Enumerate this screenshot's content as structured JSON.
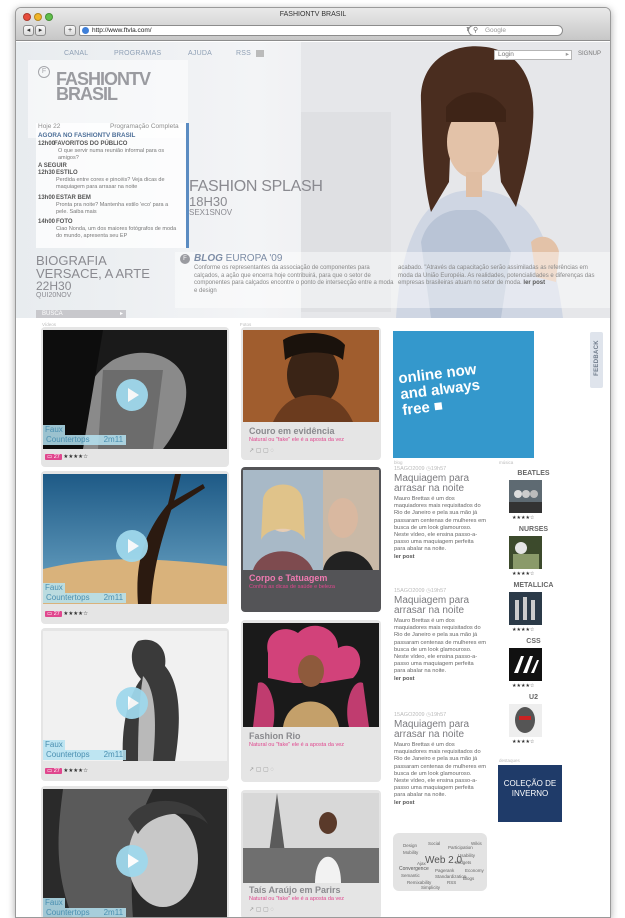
{
  "window": {
    "title": "FASHIONTV BRASIL",
    "url": "http://www.ftvla.com/",
    "search_placeholder": "Google",
    "nav_add": "+"
  },
  "topnav": {
    "items": [
      "CANAL",
      "PROGRAMAS",
      "AJUDA",
      "RSS"
    ],
    "login_placeholder": "Login",
    "signup": "SIGNUP"
  },
  "logo": {
    "line1": "FASHIONTV",
    "line2": "BRASIL"
  },
  "schedule": {
    "time_label": "Hoje 22",
    "full_label": "Programação Completa",
    "now_label": "AGORA NO FASHIONTV BRASIL",
    "now_time": "12h00",
    "now_title": "FAVORITOS DO PÚBLICO",
    "now_desc": "O que servir numa reunião informal para os amigos?",
    "next_label": "A SEGUIR",
    "items": [
      {
        "time": "12h30",
        "title": "ESTILO",
        "desc": "Perdida entre cores e pincéis? Veja dicas de maquiagem para arrasar na noite"
      },
      {
        "time": "13h00",
        "title": "ESTAR BEM",
        "desc": "Pronta pra noite? Mantenha estilo 'eco' para a pele. Saiba mais"
      },
      {
        "time": "14h00",
        "title": "FOTO",
        "desc": "Ciao Nonda, um dos maiores fotógrafos de moda do mundo, apresenta seu EP"
      }
    ]
  },
  "feature": {
    "title": "FASHION SPLASH",
    "time": "18H30",
    "day": "SEX1SNOV"
  },
  "bio": {
    "label": "BIOGRAFIA",
    "title": "VERSACE, A ARTE",
    "time": "22H30",
    "day": "QUI20NOV"
  },
  "blog": {
    "label": "BLOG",
    "title": "EUROPA '09",
    "col1": "Conforme os representantes da associação de componentes para calçados, a ação que encerra hoje contribuirá, para que o setor de componentes para calçados encontre o ponto de intersecção entre a moda e design",
    "col2": "acabado. \"Através da capacitação serão assimiladas as referências em moda da União Européia. As realidades, potencialidades e diferenças das empresas brasileiras atuam no setor de moda.",
    "more": "ler post"
  },
  "busca": "BUSCA",
  "section_labels": {
    "videos": "Vídeos",
    "fotos": "Fotos",
    "blog": "blog",
    "musica": "música",
    "destaques": "destaques"
  },
  "videos": [
    {
      "caption_l1": "Faux",
      "caption_l2": "Countertops",
      "duration": "2m11",
      "comments": "27",
      "stars": "★★★★☆"
    },
    {
      "caption_l1": "Faux",
      "caption_l2": "Countertops",
      "duration": "2m11",
      "comments": "27",
      "stars": "★★★★☆"
    },
    {
      "caption_l1": "Faux",
      "caption_l2": "Countertops",
      "duration": "2m11",
      "comments": "27",
      "stars": "★★★★☆"
    },
    {
      "caption_l1": "Faux",
      "caption_l2": "Countertops",
      "duration": "2m11",
      "comments": "27",
      "stars": "★★★★☆"
    }
  ],
  "mid_cards": [
    {
      "title": "Couro em evidência",
      "subtitle": "Natural ou \"fake\" ele é a aposta da vez"
    },
    {
      "title": "Corpo e Tatuagem",
      "subtitle": "Confira as dicas de saúde e beleza"
    },
    {
      "title": "Fashion Rio",
      "subtitle": "Natural ou \"fake\" ele é a aposta da vez"
    },
    {
      "title": "Taís Araújo em Parirs",
      "subtitle": "Natural ou \"fake\" ele é a aposta da vez"
    }
  ],
  "ad": {
    "line1": "online now",
    "line2": "and always",
    "line3": "free ■"
  },
  "posts": [
    {
      "meta": "15AGO2009 ◷19h57",
      "title": "Maquiagem para arrasar na noite",
      "text": "Mauro Brettas é um dos maquiadores mais requisitados do Rio de Janeiro e pela sua mão já passaram centenas de mulheres em busca de um look glamouroso. Neste vídeo, ele ensina passo-a-passo uma maquiagem perfeita para abalar na noite.",
      "more": "ler post"
    },
    {
      "meta": "15AGO2009 ◷19h57",
      "title": "Maquiagem para arrasar na noite",
      "text": "Mauro Brettas é um dos maquiadores mais requisitados do Rio de Janeiro e pela sua mão já passaram centenas de mulheres em busca de um look glamouroso. Neste vídeo, ele ensina passo-a-passo uma maquiagem perfeita para abalar na noite.",
      "more": "ler post"
    },
    {
      "meta": "15AGO2009 ◷19h57",
      "title": "Maquiagem para arrasar na noite",
      "text": "Mauro Brettas é um dos maquiadores mais requisitados do Rio de Janeiro e pela sua mão já passaram centenas de mulheres em busca de um look glamouroso. Neste vídeo, ele ensina passo-a-passo uma maquiagem perfeita para abalar na noite.",
      "more": "ler post"
    }
  ],
  "music": [
    {
      "name": "BEATLES",
      "stars": "★★★★☆"
    },
    {
      "name": "NURSES",
      "stars": "★★★★☆"
    },
    {
      "name": "METALLICA",
      "stars": "★★★★☆"
    },
    {
      "name": "CSS",
      "stars": "★★★★☆"
    },
    {
      "name": "U2",
      "stars": "★★★★☆"
    }
  ],
  "destaque": {
    "line1": "COLEÇÃO DE",
    "line2": "INVERNO"
  },
  "tagcloud": {
    "main": "Web 2.0",
    "words": [
      "Design",
      "Social",
      "Participation",
      "Mobility",
      "Usability",
      "Widgets",
      "Convergence",
      "Pagerank",
      "Semantic",
      "Standardization",
      "Economy",
      "Remixability",
      "Ajax",
      "RSS",
      "Blogs",
      "Wikis",
      "Simplicity"
    ]
  },
  "feedback": "FEEDBACK",
  "colors": {
    "accent": "#3498cc",
    "pink": "#e0478e",
    "caption": "#b5e3f2",
    "play": "#9fd8ec"
  }
}
